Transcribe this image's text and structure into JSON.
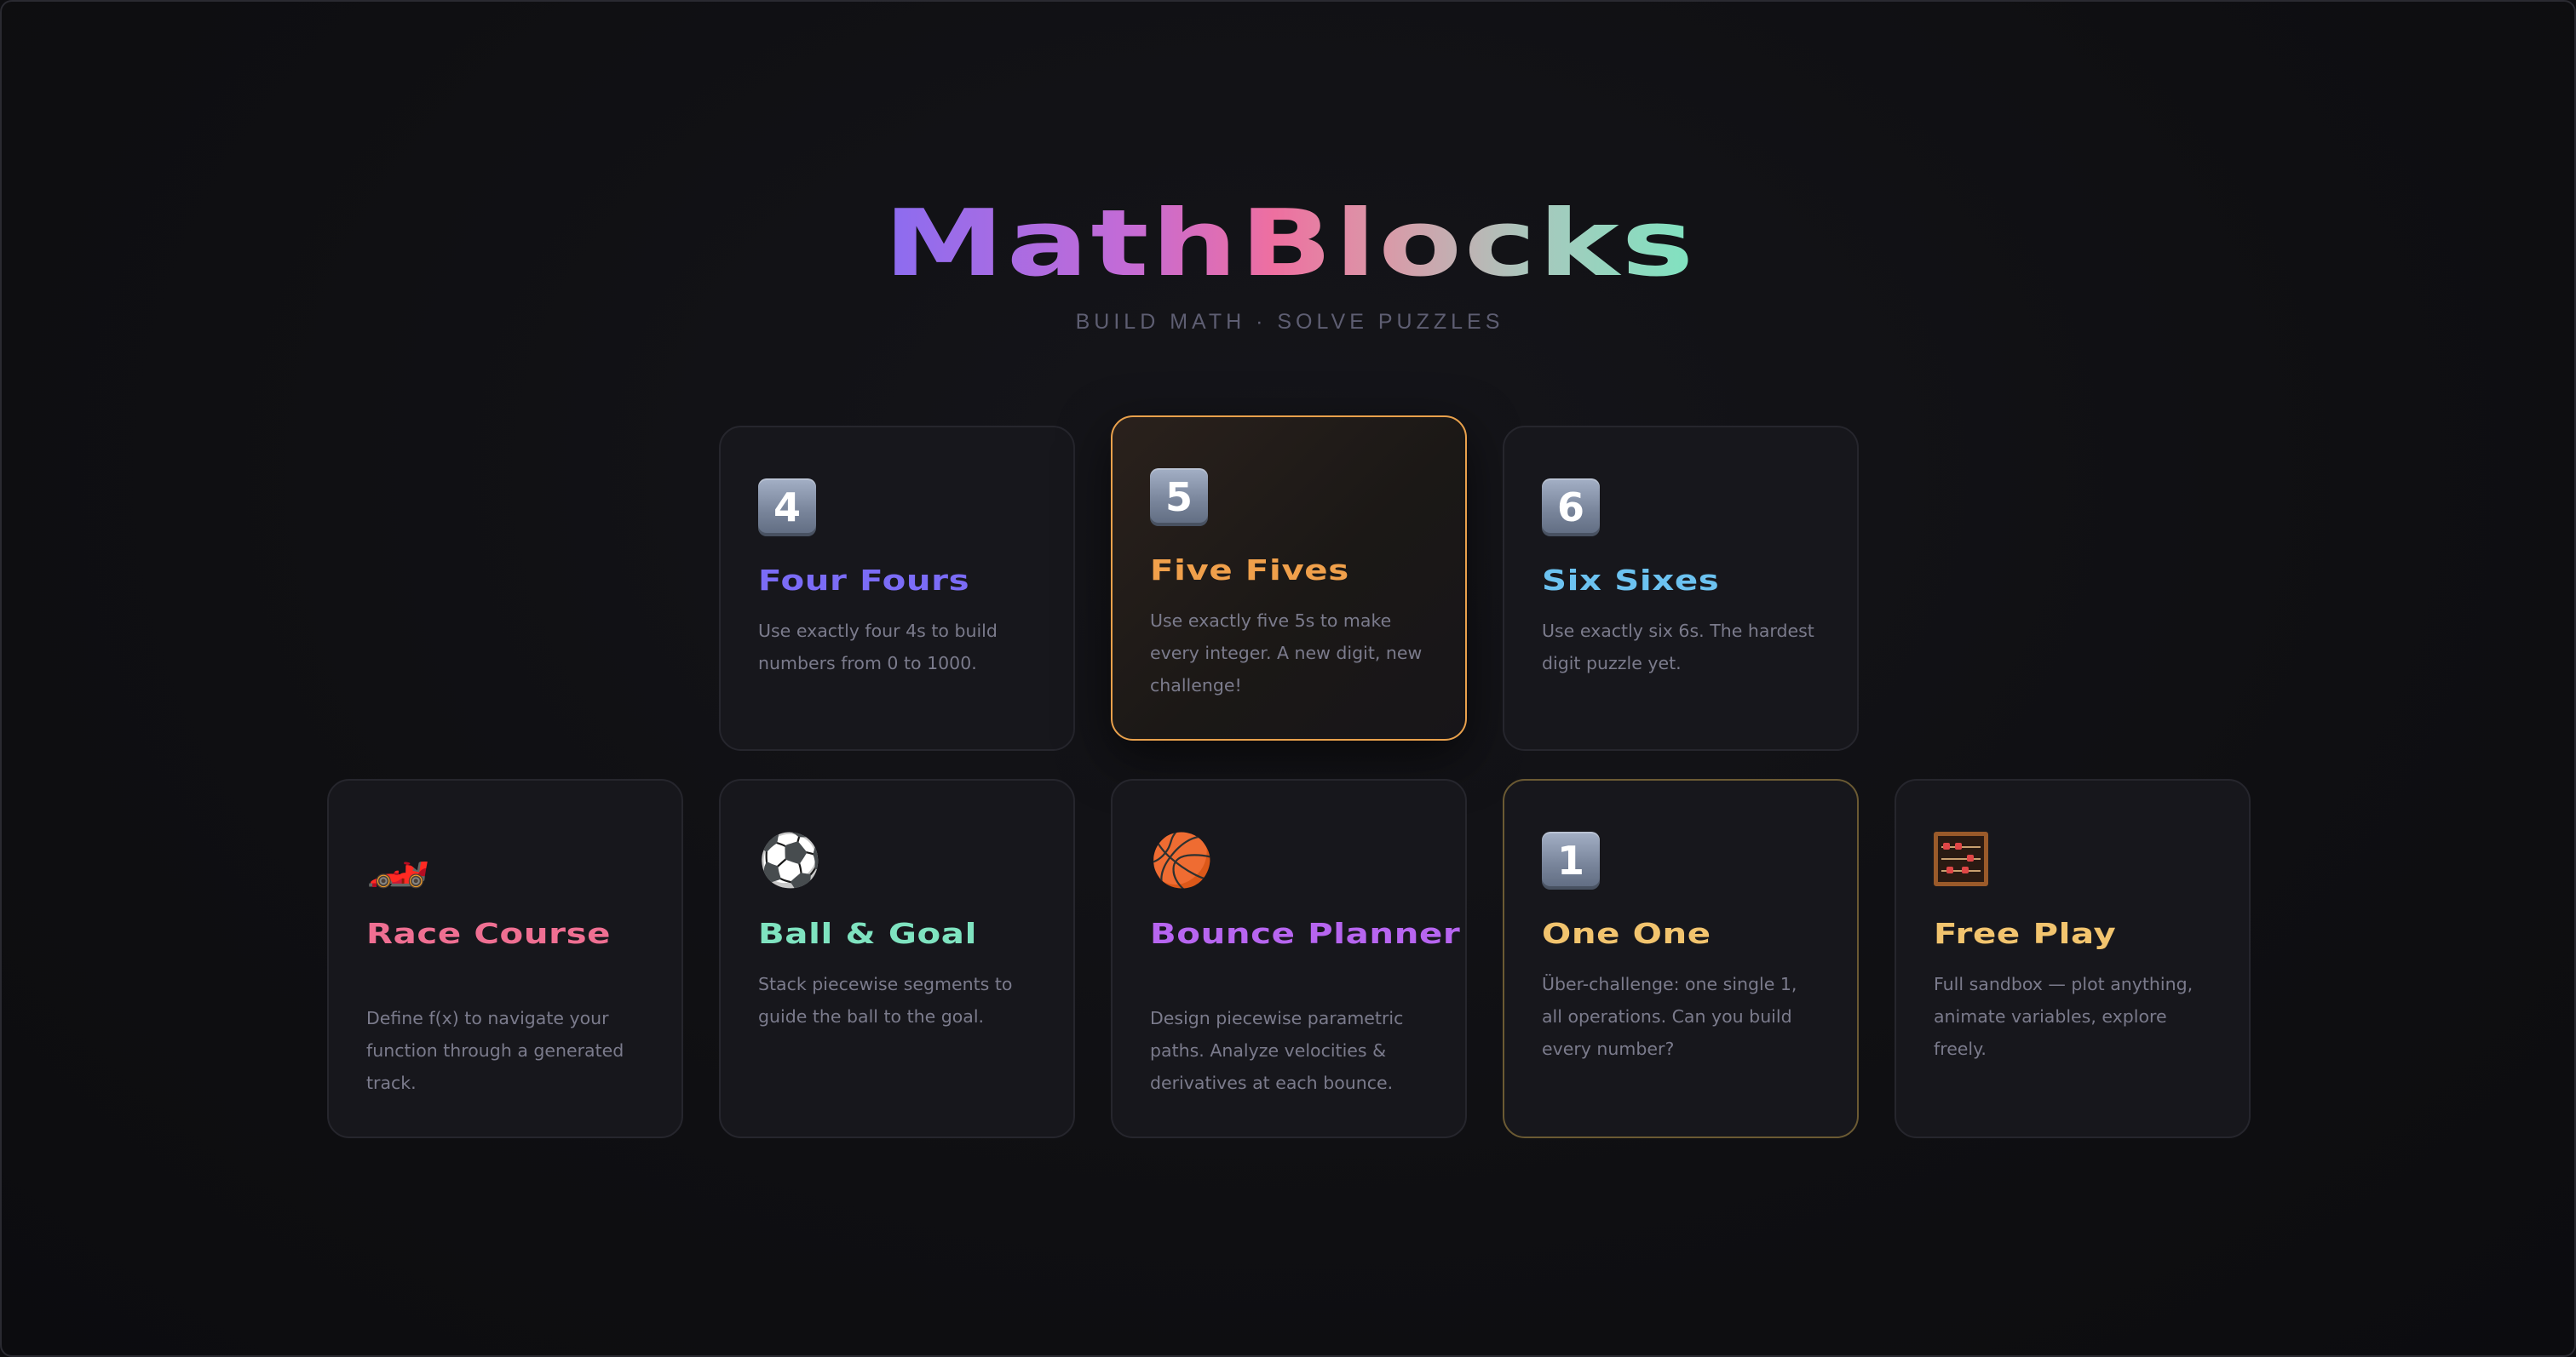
{
  "app": {
    "title": "MathBlocks",
    "subtitle": "BUILD MATH · SOLVE PUZZLES"
  },
  "colors": {
    "background": "#0e0e11",
    "card_background": "#17171c",
    "featured_border": "#e9a14c",
    "description_text": "#7b7b8c"
  },
  "cards": [
    {
      "id": "four-fours",
      "icon": "keycap-4-icon",
      "icon_text": "4",
      "title": "Four Fours",
      "title_color": "#7b6cf6",
      "description": "Use exactly four 4s to build numbers from 0 to 1000."
    },
    {
      "id": "five-fives",
      "icon": "keycap-5-icon",
      "icon_text": "5",
      "title": "Five Fives",
      "title_color": "#f0a04b",
      "description": "Use exactly five 5s to make every integer. A new digit, new challenge!",
      "featured": true
    },
    {
      "id": "six-sixes",
      "icon": "keycap-6-icon",
      "icon_text": "6",
      "title": "Six Sixes",
      "title_color": "#6cc2f0",
      "description": "Use exactly six 6s. The hardest digit puzzle yet."
    },
    {
      "id": "race-course",
      "icon": "race-car-icon",
      "icon_text": "🏎️",
      "title": "Race Course",
      "title_color": "#ef6f92",
      "description": "Define f(x) to navigate your function through a generated track."
    },
    {
      "id": "ball-goal",
      "icon": "soccer-ball-icon",
      "icon_text": "⚽",
      "title": "Ball & Goal",
      "title_color": "#7fe3c0",
      "description": "Stack piecewise segments to guide the ball to the goal."
    },
    {
      "id": "bounce-planner",
      "icon": "basketball-icon",
      "icon_text": "🏀",
      "title": "Bounce Planner",
      "title_color": "#b765f0",
      "description": "Design piecewise parametric paths. Analyze velocities & derivatives at each bounce."
    },
    {
      "id": "one-one",
      "icon": "keycap-1-icon",
      "icon_text": "1",
      "title": "One One",
      "title_color": "#f2c46e",
      "description": "Über-challenge: one single 1, all operations. Can you build every number?"
    },
    {
      "id": "free-play",
      "icon": "abacus-icon",
      "title": "Free Play",
      "title_color": "#f2c46e",
      "description": "Full sandbox — plot anything, animate variables, explore freely."
    }
  ]
}
